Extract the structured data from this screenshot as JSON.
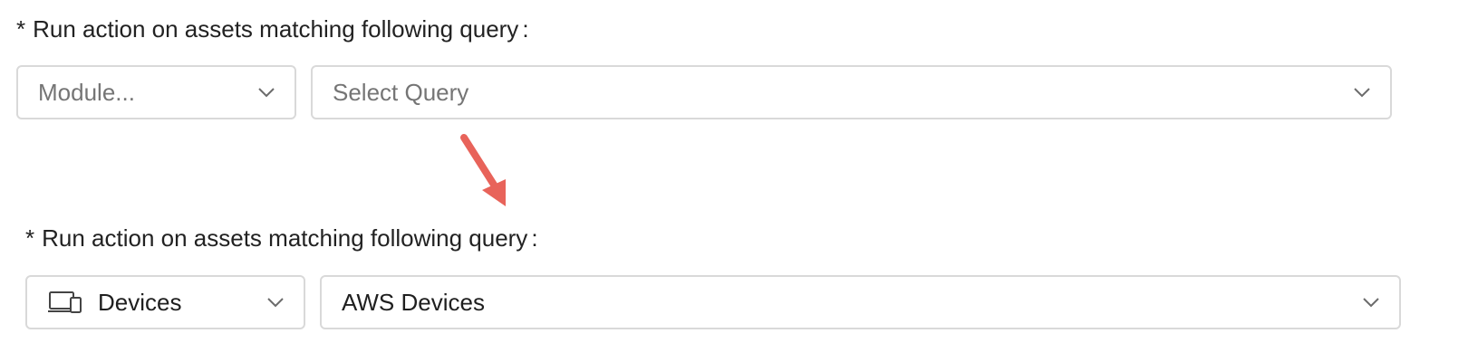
{
  "before": {
    "label": {
      "required_marker": "*",
      "text": "Run action on assets matching following query",
      "colon": ":"
    },
    "module_select": {
      "value": "Module...",
      "is_placeholder": true
    },
    "query_select": {
      "value": "Select Query",
      "is_placeholder": true
    }
  },
  "after": {
    "label": {
      "required_marker": "*",
      "text": "Run action on assets matching following query",
      "colon": ":"
    },
    "module_select": {
      "value": "Devices",
      "icon": "devices-icon",
      "is_placeholder": false
    },
    "query_select": {
      "value": "AWS Devices",
      "is_placeholder": false
    }
  },
  "annotation": {
    "icon": "annotation-arrow",
    "color": "#e8635a"
  }
}
